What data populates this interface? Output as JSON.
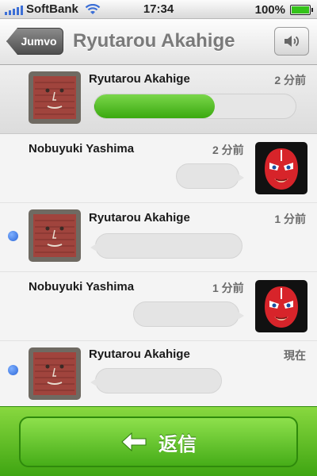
{
  "status_bar": {
    "carrier": "SoftBank",
    "time": "17:34",
    "battery_percent": "100%",
    "signal_icon": "signal-bars-icon",
    "wifi_icon": "wifi-icon",
    "battery_icon": "battery-icon"
  },
  "nav": {
    "back_label": "Jumvo",
    "title": "Ryutarou Akahige",
    "speaker_icon": "speaker-icon"
  },
  "messages": [
    {
      "sender": "Ryutarou Akahige",
      "time": "2 分前",
      "side": "left",
      "type": "voice-playing",
      "progress": 0.6,
      "unread": false
    },
    {
      "sender": "Nobuyuki Yashima",
      "time": "2 分前",
      "side": "right",
      "type": "voice",
      "unread": false
    },
    {
      "sender": "Ryutarou Akahige",
      "time": "1 分前",
      "side": "left",
      "type": "voice",
      "unread": true
    },
    {
      "sender": "Nobuyuki Yashima",
      "time": "1 分前",
      "side": "right",
      "type": "voice",
      "unread": false
    },
    {
      "sender": "Ryutarou Akahige",
      "time": "現在",
      "side": "left",
      "type": "voice",
      "unread": true
    }
  ],
  "reply": {
    "label": "返信",
    "icon": "reply-arrow-icon"
  },
  "colors": {
    "accent_green": "#46ad18",
    "unread_blue": "#2c67d8"
  }
}
